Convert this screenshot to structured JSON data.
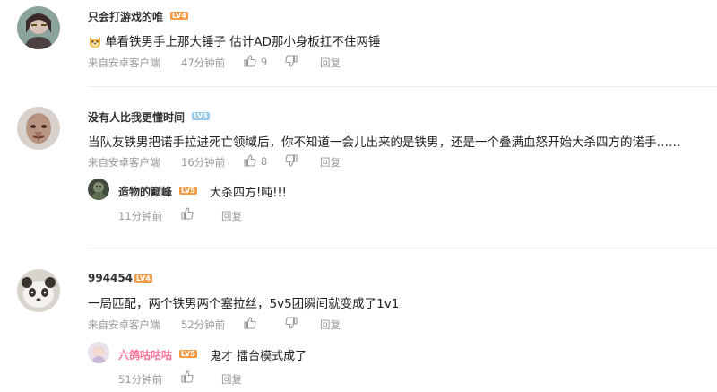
{
  "comments": [
    {
      "username": "只会打游戏的唯",
      "level": "LV4",
      "text": "单看铁男手上那大锤子 估计AD那小身板扛不住两锤",
      "emoji": "dog-face",
      "source": "来自安卓客户端",
      "time": "47分钟前",
      "likes": "9",
      "reply_label": "回复"
    },
    {
      "username": "没有人比我更懂时间",
      "level": "LV3",
      "text": "当队友铁男把诺手拉进死亡领域后，你不知道一会儿出来的是铁男，还是一个叠满血怒开始大杀四方的诺手……",
      "source": "来自安卓客户端",
      "time": "16分钟前",
      "likes": "8",
      "reply_label": "回复",
      "reply": {
        "username": "造物的巅峰",
        "level": "LV5",
        "text": "大杀四方!吨!!!",
        "time": "11分钟前",
        "reply_label": "回复"
      }
    },
    {
      "username": "994454",
      "level": "LV4",
      "text": "一局匹配，两个铁男两个塞拉丝，5v5团瞬间就变成了1v1",
      "source": "来自安卓客户端",
      "time": "52分钟前",
      "likes": "",
      "reply_label": "回复",
      "reply": {
        "username": "六鸽咕咕咕",
        "level": "LV5",
        "text": "鬼才 擂台模式成了",
        "time": "51分钟前",
        "reply_label": "回复"
      }
    }
  ],
  "colors": {
    "level_orange": "#f59b45",
    "level_blue": "#9ac8ea",
    "reply_name_pink": "#fb7299",
    "meta_gray": "#999999"
  }
}
